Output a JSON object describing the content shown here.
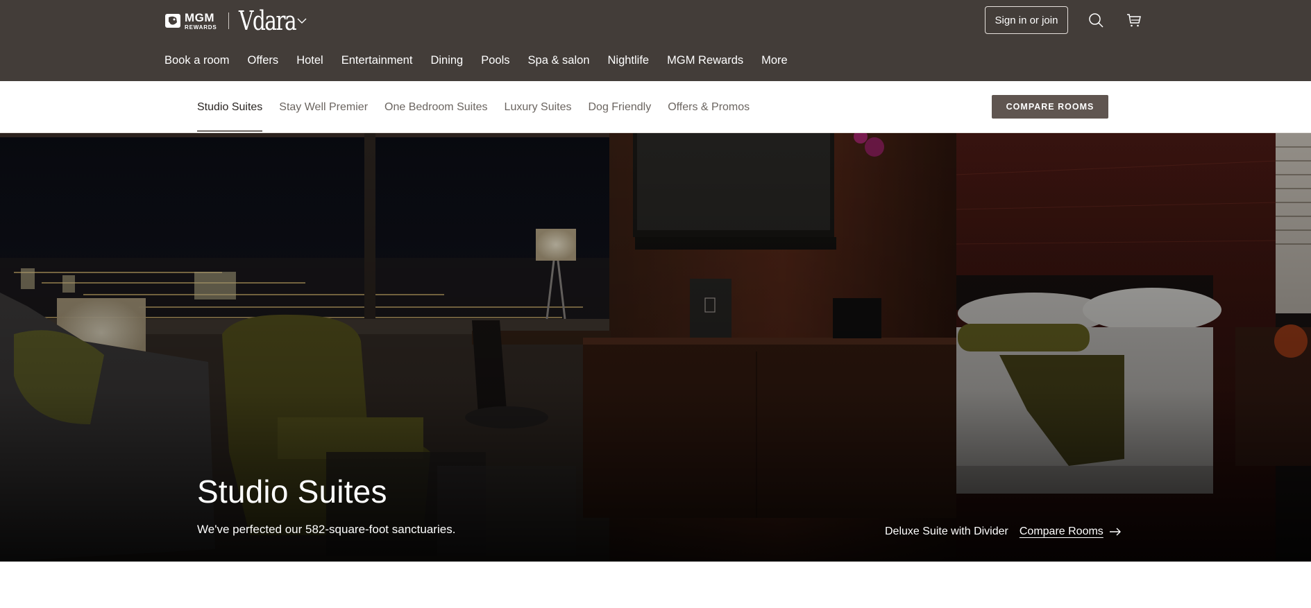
{
  "header": {
    "brand": {
      "mgm_line1": "MGM",
      "mgm_line2": "REWARDS",
      "property": "Vdara"
    },
    "signin_label": "Sign in or join",
    "icons": [
      "search-icon",
      "cart-icon",
      "chevron-down-icon"
    ],
    "nav": [
      {
        "label": "Book a room"
      },
      {
        "label": "Offers"
      },
      {
        "label": "Hotel"
      },
      {
        "label": "Entertainment"
      },
      {
        "label": "Dining"
      },
      {
        "label": "Pools"
      },
      {
        "label": "Spa & salon"
      },
      {
        "label": "Nightlife"
      },
      {
        "label": "MGM Rewards"
      },
      {
        "label": "More"
      }
    ]
  },
  "subnav": {
    "tabs": [
      {
        "label": "Studio Suites",
        "active": true
      },
      {
        "label": "Stay Well Premier"
      },
      {
        "label": "One Bedroom Suites"
      },
      {
        "label": "Luxury Suites"
      },
      {
        "label": "Dog Friendly"
      },
      {
        "label": "Offers & Promos"
      }
    ],
    "compare_label": "COMPARE ROOMS"
  },
  "hero": {
    "title": "Studio Suites",
    "subtitle": "We've perfected our 582-square-foot sanctuaries.",
    "suite_name": "Deluxe Suite with Divider",
    "compare_link": "Compare Rooms"
  },
  "colors": {
    "header_bg": "#433d39",
    "button_bg": "#5f5550",
    "tab_text": "#6b6560"
  }
}
